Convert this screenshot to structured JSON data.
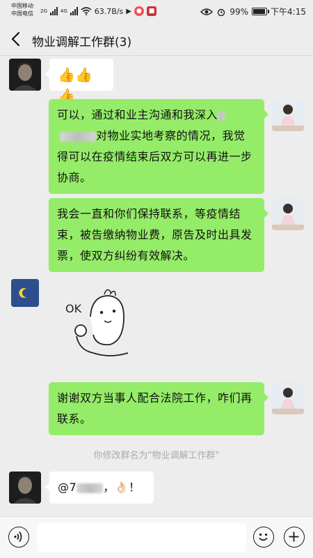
{
  "status_bar": {
    "carrier_1": "中国移动",
    "carrier_2": "中国电信",
    "net_1": "2G",
    "net_2": "4G",
    "speed": "63.7B/s",
    "battery": "99%",
    "time": "下午4:15",
    "battery_level": 0.99
  },
  "header": {
    "title": "物业调解工作群(3)"
  },
  "messages": [
    {
      "side": "left",
      "sender_avatar": "man-avatar",
      "text": "👍👍👍"
    },
    {
      "side": "right",
      "sender_avatar": "girl-avatar",
      "text_a": "可以，通过和业主沟通和我深入",
      "text_b": "对物业实地考察的情况，我觉得可以在疫情结束后双方可以再进一步协商。"
    },
    {
      "side": "right",
      "sender_avatar": "girl-avatar",
      "text": "我会一直和你们保持联系，等疫情结束，被告缴纳物业费，原告及时出具发票，使双方纠纷有效解决。"
    },
    {
      "side": "left",
      "sender_avatar": "blue-avatar",
      "sticker_text": "OK"
    },
    {
      "side": "right",
      "sender_avatar": "girl-avatar",
      "text": "谢谢双方当事人配合法院工作，咋们再联系。"
    },
    {
      "side": "left",
      "sender_avatar": "man-avatar",
      "text_a": "@7",
      "text_b": "，👌🏻！"
    }
  ],
  "system_note": "你修改群名为\"物业调解工作群\"",
  "input_bar": {
    "placeholder": ""
  },
  "colors": {
    "background": "#ededed",
    "bubble_self": "#95ec69",
    "bubble_other": "#ffffff"
  }
}
